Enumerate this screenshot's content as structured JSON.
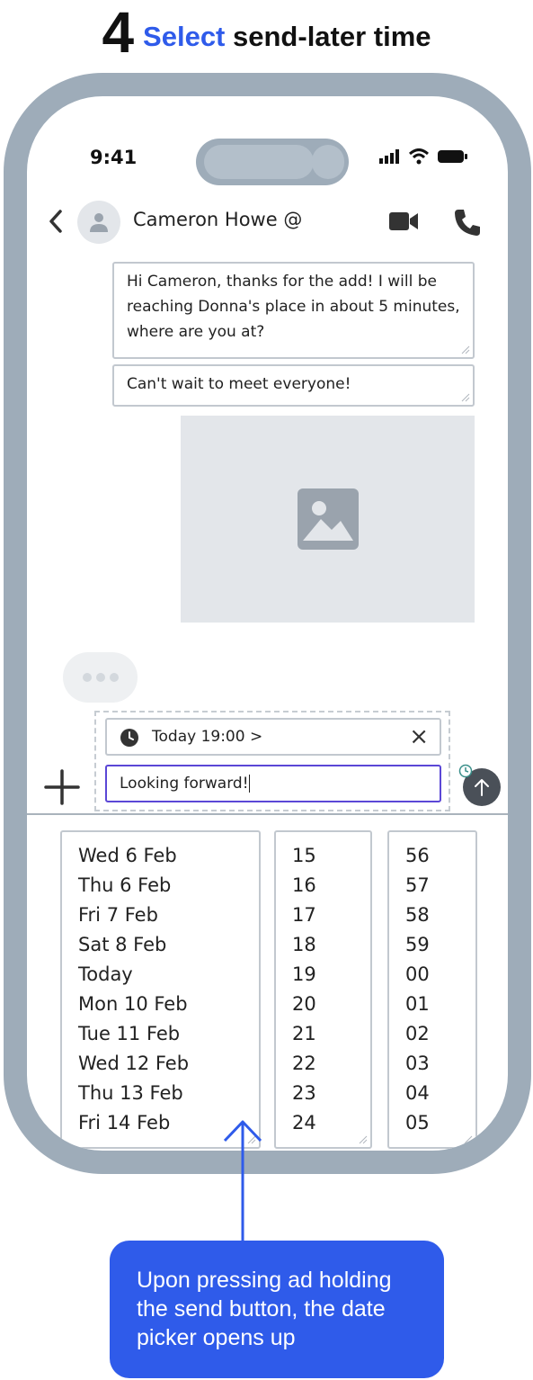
{
  "step": {
    "number": "4",
    "accent": "Select",
    "rest": "send-later time"
  },
  "status_bar": {
    "time": "9:41"
  },
  "header": {
    "contact_name": "Cameron Howe",
    "mention_symbol": "@"
  },
  "messages": [
    {
      "text": "Hi Cameron, thanks for the add! I will be reaching Donna's place in about 5 minutes, where are you at?"
    },
    {
      "text": "Can't wait to meet everyone!"
    }
  ],
  "composer": {
    "schedule_label": "Today 19:00",
    "schedule_chevron": ">",
    "close_symbol": "×",
    "message_value": "Looking forward!"
  },
  "picker": {
    "days": [
      "Wed 6 Feb",
      "Thu 6 Feb",
      "Fri 7 Feb",
      "Sat 8 Feb",
      "Today",
      "Mon 10 Feb",
      "Tue 11 Feb",
      "Wed 12 Feb",
      "Thu 13 Feb",
      "Fri 14 Feb"
    ],
    "hours": [
      "15",
      "16",
      "17",
      "18",
      "19",
      "20",
      "21",
      "22",
      "23",
      "24"
    ],
    "minutes": [
      "56",
      "57",
      "58",
      "59",
      "00",
      "01",
      "02",
      "03",
      "04",
      "05"
    ]
  },
  "callout": {
    "text": "Upon pressing ad holding the send button, the date picker opens up"
  },
  "icons": {
    "back": "chevron-left-icon",
    "avatar": "user-icon",
    "video": "video-camera-icon",
    "call": "phone-icon",
    "image": "image-icon",
    "clock": "clock-icon",
    "plus": "plus-icon",
    "send": "arrow-up-icon"
  },
  "colors": {
    "accent": "#2f5bea",
    "phone_frame": "#9eacb9",
    "input_focus": "#5b47d6",
    "send_button": "#4a5058"
  }
}
